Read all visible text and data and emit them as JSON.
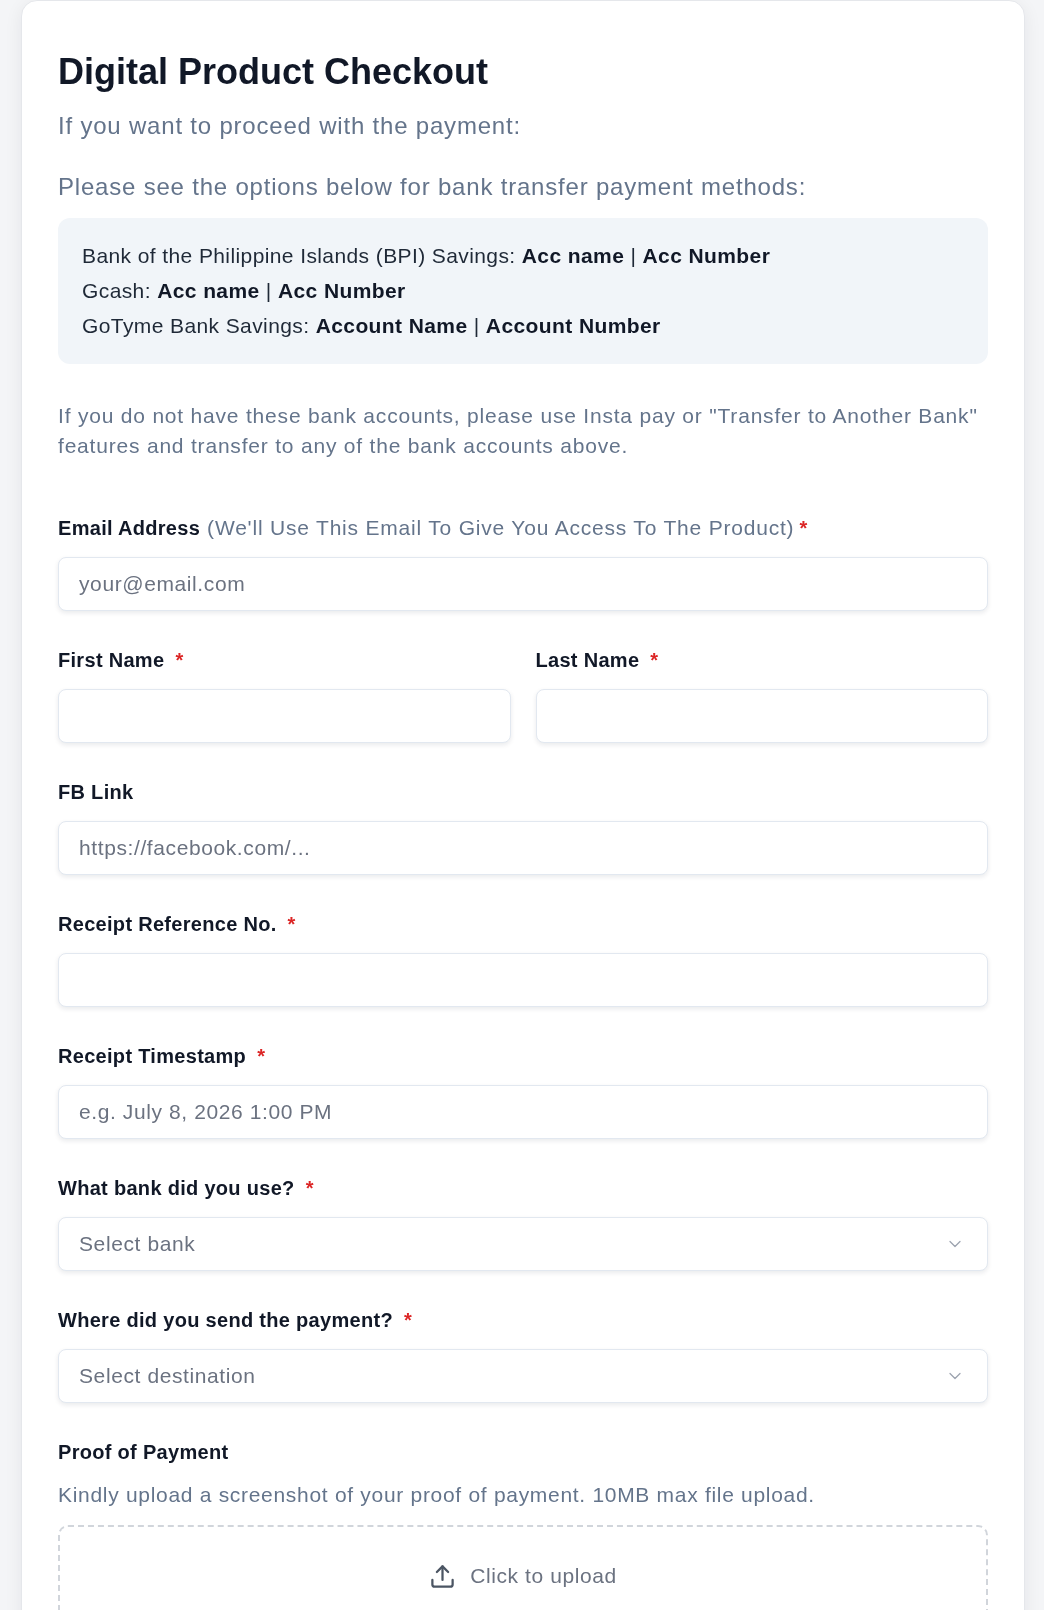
{
  "title": "Digital Product Checkout",
  "intro": [
    "If you want to proceed with the payment:",
    "Please see the options below for bank transfer payment methods:"
  ],
  "accounts": [
    "Bank of the Philippine Islands (BPI) Savings: **Acc name** | **Acc Number**",
    "Gcash: **Acc name** | **Acc Number**",
    "GoTyme Bank Savings: **Account Name** | **Account Number**"
  ],
  "note": "If you do not have these bank accounts, please use Insta pay or \"Transfer to Another Bank\" features and transfer to any of the bank accounts above.",
  "fields": [
    {
      "kind": "text",
      "label": "Email Address",
      "label_note": "(We'll Use This Email To Give You Access To The Product)",
      "required_mark": "*",
      "placeholder": "your@email.com"
    },
    {
      "kind": "pair",
      "fields": [
        {
          "kind": "text",
          "label": "First Name",
          "required_mark": "*"
        },
        {
          "kind": "text",
          "label": "Last Name",
          "required_mark": "*"
        }
      ]
    },
    {
      "kind": "text",
      "label": "FB Link",
      "placeholder": "https://facebook.com/..."
    },
    {
      "kind": "text",
      "label": "Receipt Reference No.",
      "required_mark": "*"
    },
    {
      "kind": "text",
      "label": "Receipt Timestamp",
      "required_mark": "*",
      "placeholder": "e.g. July 8, 2026 1:00 PM"
    },
    {
      "kind": "select",
      "label": "What bank did you use?",
      "required_mark": "*",
      "placeholder": "Select bank"
    },
    {
      "kind": "select",
      "label": "Where did you send the payment?",
      "required_mark": "*",
      "placeholder": "Select destination"
    },
    {
      "kind": "upload",
      "label": "Proof of Payment",
      "description": "Kindly upload a screenshot of your proof of payment. 10MB max file upload.",
      "prompt": "Click to upload"
    }
  ]
}
